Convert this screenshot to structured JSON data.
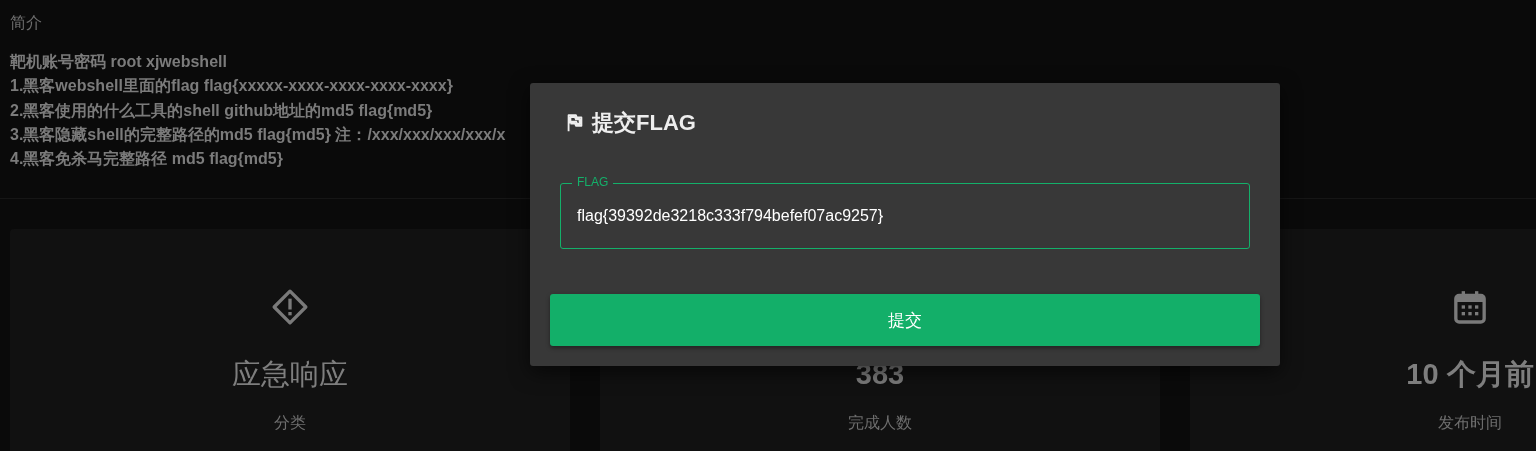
{
  "intro": {
    "title": "简介",
    "lines": [
      "靶机账号密码 root xjwebshell",
      "1.黑客webshell里面的flag flag{xxxxx-xxxx-xxxx-xxxx-xxxx}",
      "2.黑客使用的什么工具的shell github地址的md5 flag{md5}",
      "3.黑客隐藏shell的完整路径的md5 flag{md5} 注：/xxx/xxx/xxx/xxx/x",
      "4.黑客免杀马完整路径 md5 flag{md5}"
    ]
  },
  "cards": [
    {
      "kind": "category",
      "value": "应急响应",
      "label": "分类"
    },
    {
      "kind": "count",
      "value": "383",
      "label": "完成人数"
    },
    {
      "kind": "date",
      "value": "10 个月前",
      "label": "发布时间"
    }
  ],
  "dialog": {
    "title": "提交FLAG",
    "field": {
      "label": "FLAG",
      "value": "flag{39392de3218c333f794befef07ac9257}"
    },
    "button": "提交"
  }
}
